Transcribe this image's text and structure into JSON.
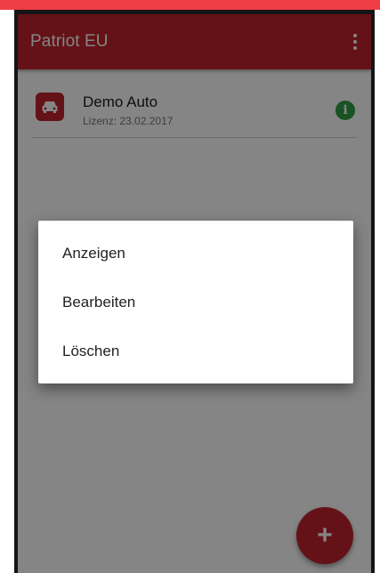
{
  "app": {
    "title": "Patriot EU",
    "accent_color": "#c0242d"
  },
  "list": {
    "items": [
      {
        "title": "Demo Auto",
        "subtitle": "Lizenz: 23.02.2017",
        "icon": "car-icon",
        "status_icon": "info-icon"
      }
    ]
  },
  "context_menu": {
    "items": [
      {
        "label": "Anzeigen"
      },
      {
        "label": "Bearbeiten"
      },
      {
        "label": "Löschen"
      }
    ]
  },
  "fab": {
    "label": "+",
    "icon": "plus-icon"
  }
}
